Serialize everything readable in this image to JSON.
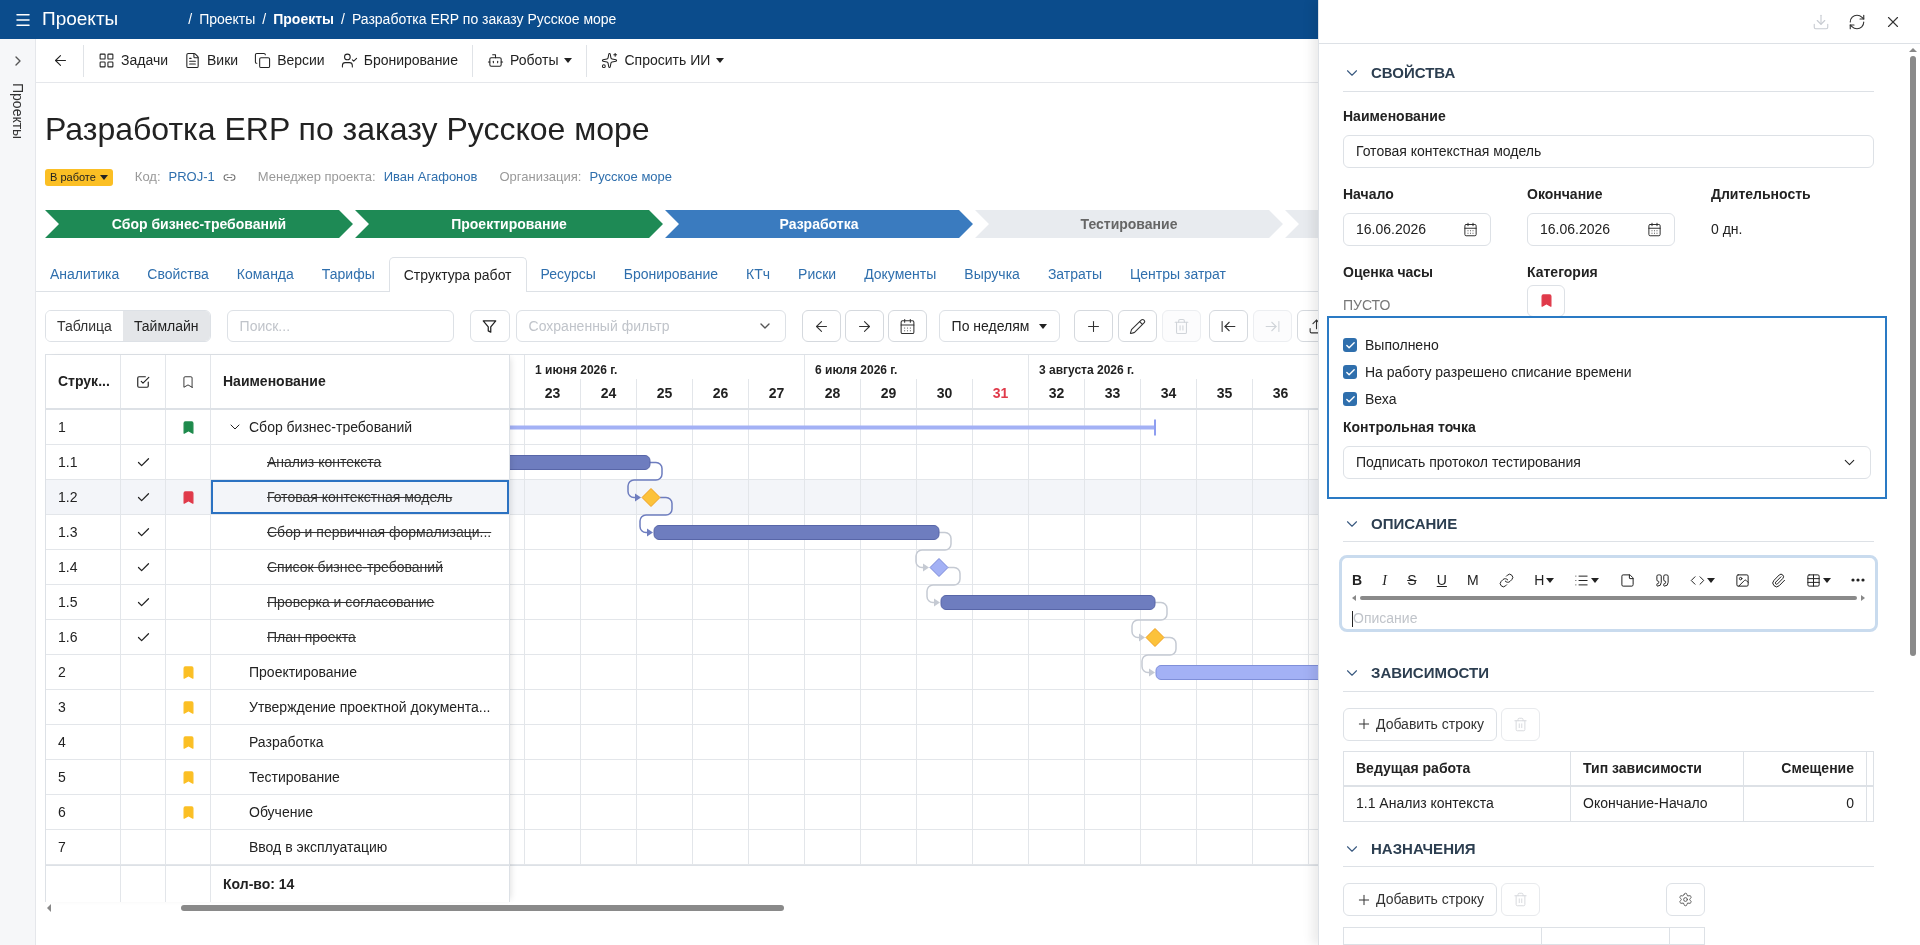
{
  "topbar": {
    "app_title": "Проекты",
    "separator": "/",
    "breadcrumbs": [
      {
        "label": "Проекты"
      },
      {
        "label": "Проекты"
      },
      {
        "label": "Разработка ERP по заказу Русское море"
      }
    ]
  },
  "side_rail": {
    "label": "Проекты"
  },
  "toolbar": [
    {
      "kind": "back",
      "separator_before": false,
      "dropdown": false
    },
    {
      "kind": "tasks",
      "label": "Задачи",
      "separator_before": true,
      "dropdown": false
    },
    {
      "kind": "wiki",
      "label": "Вики",
      "separator_before": false,
      "dropdown": false
    },
    {
      "kind": "versions",
      "label": "Версии",
      "separator_before": false,
      "dropdown": false
    },
    {
      "kind": "booking",
      "label": "Бронирование",
      "separator_before": false,
      "dropdown": false
    },
    {
      "kind": "robots",
      "label": "Роботы",
      "separator_before": true,
      "dropdown": true
    },
    {
      "kind": "ai",
      "label": "Спросить ИИ",
      "separator_before": true,
      "dropdown": true
    }
  ],
  "project": {
    "title": "Разработка ERP по заказу Русское море",
    "status": "В работе",
    "meta": [
      {
        "kind": "code",
        "label": "Код:",
        "value": "PROJ-1"
      },
      {
        "kind": "link",
        "label": "Менеджер проекта:",
        "value": "Иван Агафонов"
      },
      {
        "kind": "link",
        "label": "Организация:",
        "value": "Русское море"
      }
    ]
  },
  "stages": [
    {
      "label": "Сбор бизнес-требований",
      "done": true,
      "current": false
    },
    {
      "label": "Проектирование",
      "done": true,
      "current": false
    },
    {
      "label": "Разработка",
      "done": false,
      "current": true
    },
    {
      "label": "Тестирование",
      "done": false,
      "current": false
    },
    {
      "done": false,
      "current": false
    }
  ],
  "tabs": [
    {
      "label": "Аналитика",
      "selected": false
    },
    {
      "label": "Свойства",
      "selected": false
    },
    {
      "label": "Команда",
      "selected": false
    },
    {
      "label": "Тарифы",
      "selected": false
    },
    {
      "label": "Структура работ",
      "selected": true
    },
    {
      "label": "Ресурсы",
      "selected": false
    },
    {
      "label": "Бронирование",
      "selected": false
    },
    {
      "label": "КТч",
      "selected": false
    },
    {
      "label": "Риски",
      "selected": false
    },
    {
      "label": "Документы",
      "selected": false
    },
    {
      "label": "Выручка",
      "selected": false
    },
    {
      "label": "Затраты",
      "selected": false
    },
    {
      "label": "Центры затрат",
      "selected": false
    }
  ],
  "gantt_toolbar": {
    "views": [
      {
        "label": "Таблица",
        "selected": false
      },
      {
        "label": "Таймлайн",
        "selected": true
      }
    ],
    "search": {
      "placeholder": "Поиск..."
    },
    "saved_filter": {
      "placeholder": "Сохраненный фильтр"
    },
    "nav_buttons": [
      {
        "kind": "prev",
        "disabled": false
      },
      {
        "kind": "next",
        "disabled": false
      },
      {
        "kind": "calendar",
        "disabled": false
      }
    ],
    "scale": {
      "label": "По неделям"
    },
    "edit_buttons": [
      {
        "kind": "add",
        "disabled": false
      },
      {
        "kind": "edit",
        "disabled": false
      },
      {
        "kind": "delete",
        "disabled": true
      }
    ],
    "move_buttons": [
      {
        "kind": "outdent",
        "disabled": false
      },
      {
        "kind": "indent",
        "disabled": true
      },
      {
        "kind": "export",
        "disabled": false
      }
    ]
  },
  "table": {
    "columns": [
      {
        "kind": "text",
        "label": "Струк..."
      },
      {
        "kind": "done"
      },
      {
        "kind": "flag"
      },
      {
        "kind": "text",
        "label": "Наименование"
      }
    ],
    "rows": [
      {
        "number": "1",
        "done": false,
        "color": "#1e8a4c",
        "name": "Сбор бизнес-требований",
        "selected": false,
        "expanded": true,
        "children": [
          {
            "number": "1.1",
            "done": true,
            "name": "Анализ контекста",
            "selected": false
          },
          {
            "number": "1.2",
            "done": true,
            "color": "#e03a4a",
            "name": "Готовая контекстная модель",
            "selected": true
          },
          {
            "number": "1.3",
            "done": true,
            "name": "Сбор и первичная формализаци...",
            "selected": false
          },
          {
            "number": "1.4",
            "done": true,
            "name": "Список бизнес-требований",
            "selected": false
          },
          {
            "number": "1.5",
            "done": true,
            "name": "Проверка и согласование",
            "selected": false
          },
          {
            "number": "1.6",
            "done": true,
            "name": "План проекта",
            "selected": false
          }
        ]
      },
      {
        "number": "2",
        "done": false,
        "color": "#fbbf24",
        "name": "Проектирование",
        "selected": false
      },
      {
        "number": "3",
        "done": false,
        "color": "#fbbf24",
        "name": "Утверждение проектной документа...",
        "selected": false
      },
      {
        "number": "4",
        "done": false,
        "color": "#fbbf24",
        "name": "Разработка",
        "selected": false
      },
      {
        "number": "5",
        "done": false,
        "color": "#fbbf24",
        "name": "Тестирование",
        "selected": false
      },
      {
        "number": "6",
        "done": false,
        "color": "#fbbf24",
        "name": "Обучение",
        "selected": false
      },
      {
        "number": "7",
        "done": false,
        "name": "Ввод в эксплуатацию",
        "selected": false
      }
    ],
    "footer": "Кол-во: 14"
  },
  "timeline": {
    "months": [
      {
        "label": "1 июня 2026 г.",
        "weeks": [
          {
            "label": "23",
            "current": false
          },
          {
            "label": "24",
            "current": false
          },
          {
            "label": "25",
            "current": false
          },
          {
            "label": "26",
            "current": false
          },
          {
            "label": "27",
            "current": false
          }
        ]
      },
      {
        "label": "6 июля 2026 г.",
        "weeks": [
          {
            "label": "28",
            "current": false
          },
          {
            "label": "29",
            "current": false
          },
          {
            "label": "30",
            "current": false
          },
          {
            "label": "31",
            "current": true
          }
        ]
      },
      {
        "label": "3 августа 2026 г.",
        "weeks": [
          {
            "label": "32",
            "current": false
          },
          {
            "label": "33",
            "current": false
          },
          {
            "label": "34",
            "current": false
          },
          {
            "label": "35",
            "current": false
          },
          {
            "label": "36",
            "current": false
          }
        ]
      }
    ]
  },
  "panel": {
    "header_buttons": [
      {
        "kind": "save",
        "disabled": true
      },
      {
        "kind": "refresh",
        "disabled": false
      },
      {
        "kind": "close",
        "disabled": false
      }
    ],
    "properties": {
      "title": "СВОЙСТВА",
      "expanded": true,
      "name_label": "Наименование",
      "name_value": "Готовая контекстная модель",
      "start_label": "Начало",
      "start_value": "16.06.2026",
      "end_label": "Окончание",
      "end_value": "16.06.2026",
      "duration_label": "Длительность",
      "duration_value": "0 дн.",
      "estimate_label": "Оценка часы",
      "estimate_value": "ПУСТО",
      "category": {
        "label": "Категория",
        "color": "#e03a4a"
      },
      "checkboxes": [
        {
          "label": "Выполнено",
          "checked": true
        },
        {
          "label": "На работу разрешено списание времени",
          "checked": true
        },
        {
          "label": "Веха",
          "checked": true
        }
      ],
      "checkpoint_label": "Контрольная точка",
      "checkpoint_value": "Подписать протокол тестирования"
    },
    "description": {
      "title": "ОПИСАНИЕ",
      "expanded": true,
      "placeholder": "Описание",
      "tools": [
        {
          "kind": "bold",
          "label": "B",
          "dropdown": false
        },
        {
          "kind": "italic",
          "label": "I",
          "dropdown": false
        },
        {
          "kind": "strike",
          "label": "S",
          "dropdown": false
        },
        {
          "kind": "underline",
          "label": "U",
          "dropdown": false
        },
        {
          "kind": "mono",
          "label": "M",
          "dropdown": false
        },
        {
          "kind": "link",
          "dropdown": false
        },
        {
          "kind": "heading",
          "label": "H",
          "dropdown": true
        },
        {
          "kind": "list",
          "dropdown": true
        },
        {
          "kind": "note",
          "dropdown": false
        },
        {
          "kind": "quote",
          "dropdown": false
        },
        {
          "kind": "code",
          "dropdown": true
        },
        {
          "kind": "image",
          "dropdown": false
        },
        {
          "kind": "attach",
          "dropdown": false
        },
        {
          "kind": "table",
          "dropdown": true
        },
        {
          "kind": "more",
          "dropdown": false
        }
      ]
    },
    "dependencies": {
      "title": "ЗАВИСИМОСТИ",
      "expanded": true,
      "add_label": "Добавить строку",
      "columns": [
        "Ведущая работа",
        "Тип зависимости",
        "Смещение"
      ],
      "rows": [
        [
          "1.1 Анализ контекста",
          "Окончание-Начало",
          "0"
        ]
      ]
    },
    "assignments": {
      "title": "НАЗНАЧЕНИЯ",
      "expanded": true,
      "add_label": "Добавить строку"
    }
  }
}
